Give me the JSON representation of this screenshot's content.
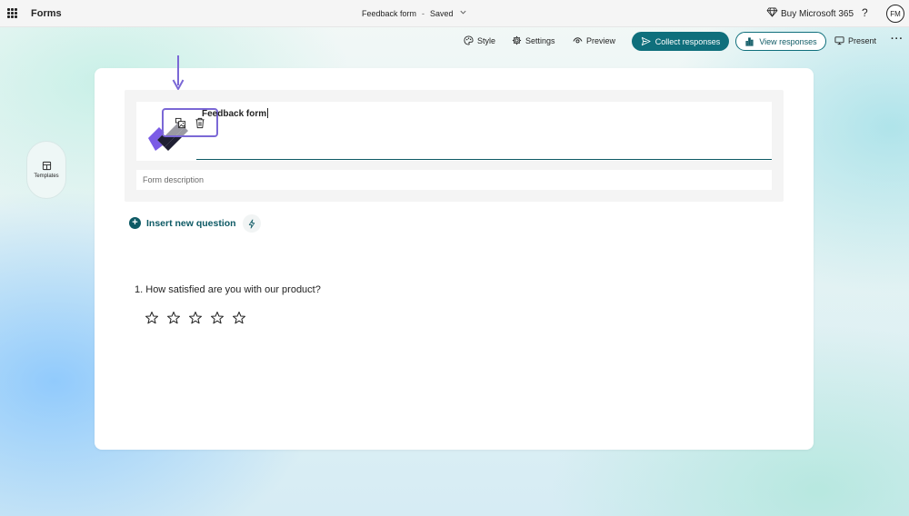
{
  "topbar": {
    "app_name": "Forms",
    "doc_title": "Feedback form",
    "separator": "-",
    "save_status": "Saved",
    "buy_label": "Buy Microsoft 365",
    "help_label": "?",
    "avatar_initials": "FM"
  },
  "toolbar": {
    "style_label": "Style",
    "settings_label": "Settings",
    "preview_label": "Preview",
    "collect_label": "Collect responses",
    "view_label": "View responses",
    "present_label": "Present",
    "more_label": "···"
  },
  "sidebar": {
    "templates_label": "Templates"
  },
  "form": {
    "title": "Feedback form",
    "description_placeholder": "Form description",
    "insert_label": "Insert new question",
    "questions": [
      {
        "number": "1.",
        "text": "How satisfied are you with our product?",
        "type": "rating",
        "max_stars": 5
      }
    ]
  },
  "colors": {
    "accent": "#0e5a65",
    "primary_button": "#0f6f7c",
    "selection_outline": "#7b68d6",
    "logo_purple": "#7b5ce6",
    "logo_dark": "#1f1f33"
  },
  "icons": {
    "waffle": "app-launcher-icon",
    "diamond": "diamond-icon",
    "style": "palette-icon",
    "settings": "gear-icon",
    "preview": "eye-icon",
    "collect": "send-icon",
    "view": "chart-icon",
    "present": "monitor-icon",
    "templates": "layout-icon",
    "replace_image": "image-swap-icon",
    "delete": "trash-icon",
    "insert": "plus-circle-icon",
    "quick_suggest": "lightning-icon",
    "rating": "star-icon"
  }
}
